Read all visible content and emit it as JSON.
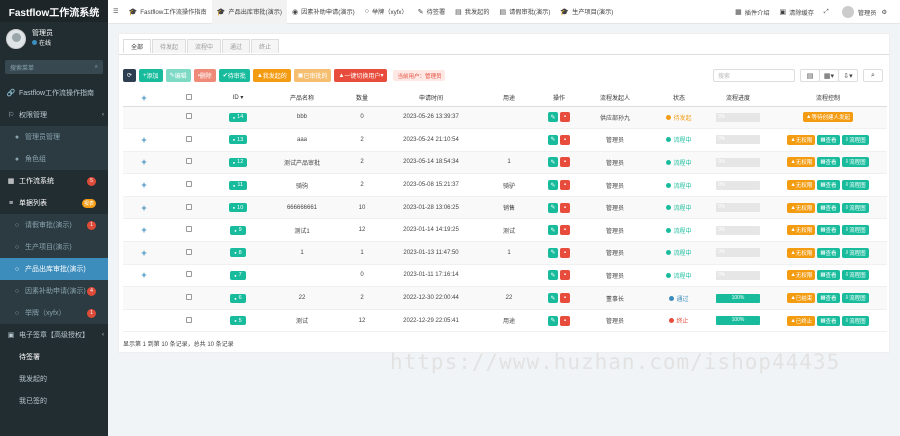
{
  "app": {
    "title": "Fastflow工作流系统"
  },
  "user": {
    "name": "管理员",
    "status": "在线"
  },
  "search": {
    "placeholder": "搜索菜单"
  },
  "menu": [
    {
      "label": "Fastflow工作流操作指南",
      "icon": "link-icon",
      "active": false
    },
    {
      "label": "权限管理",
      "icon": "shield-icon",
      "arrow": "‹"
    },
    {
      "label": "管理员管理",
      "icon": "user-icon",
      "sub": true
    },
    {
      "label": "角色组",
      "icon": "group-icon",
      "sub": true
    },
    {
      "label": "工作流系统",
      "icon": "flow-icon",
      "badge": "5",
      "badge_color": "red",
      "parent": true
    },
    {
      "label": "单据列表",
      "icon": "list-icon",
      "badge": "报表",
      "badge_color": "orange",
      "parent": true
    },
    {
      "label": "请假审批(演示)",
      "icon": "circle-icon",
      "sub": true,
      "badge": "1",
      "badge_color": "red"
    },
    {
      "label": "生产项目(演示)",
      "icon": "circle-icon",
      "sub": true
    },
    {
      "label": "产品出库审批(演示)",
      "icon": "circle-icon",
      "sub": true,
      "active": true
    },
    {
      "label": "因素补助申请(演示)",
      "icon": "circle-icon",
      "sub": true,
      "badge": "4",
      "badge_color": "red"
    },
    {
      "label": "举牌（xyfx）",
      "icon": "circle-icon",
      "sub": true,
      "badge": "1",
      "badge_color": "red"
    },
    {
      "label": "电子签章【高级授权】",
      "icon": "stamp-icon",
      "arrow": "‹"
    },
    {
      "label": "待签署",
      "icon": "",
      "parent": true
    },
    {
      "label": "我发起的",
      "icon": ""
    },
    {
      "label": "我已签的",
      "icon": ""
    }
  ],
  "topbar": {
    "tabs": [
      {
        "label": "Fastflow工作流操作指南",
        "icon": "cap-icon"
      },
      {
        "label": "产品出库审批(演示)",
        "icon": "cap-icon",
        "active": true
      },
      {
        "label": "因素补助申请(演示)",
        "icon": "eye-icon"
      },
      {
        "label": "举牌（xyfx）",
        "icon": "circle-icon"
      },
      {
        "label": "待签署",
        "icon": "pen-icon"
      },
      {
        "label": "我发起的",
        "icon": "doc-icon"
      },
      {
        "label": "请假审批(演示)",
        "icon": "doc-icon"
      },
      {
        "label": "生产项目(演示)",
        "icon": "cap-icon"
      }
    ],
    "right": {
      "plugin": "插件介绍",
      "clear": "清除缓存",
      "user": "管理员"
    }
  },
  "filter_tabs": [
    "全部",
    "待发起",
    "流程中",
    "通过",
    "终止"
  ],
  "toolbar": {
    "add": "添加",
    "edit": "编辑",
    "delete": "删除",
    "pending": "待审批",
    "mine": "我发起的",
    "done": "已审批的",
    "switch_user": "一键切换用户",
    "current_user": "当前用户：管理员"
  },
  "table_search": {
    "placeholder": "搜索"
  },
  "columns": [
    "ID",
    "产品名称",
    "数量",
    "申请时间",
    "用途",
    "操作",
    "流程发起人",
    "状态",
    "流程进度",
    "流程控制"
  ],
  "rows": [
    {
      "id": "14",
      "name": "bbb",
      "qty": "0",
      "time": "2023-05-26 13:39:37",
      "use": "",
      "initiator": "供应部孙九",
      "status": "待发起",
      "status_color": "#f39c12",
      "progress": "0%",
      "progress_value": 0,
      "controls": [
        "等待创建人发起"
      ],
      "expand": false
    },
    {
      "id": "13",
      "name": "aaa",
      "qty": "2",
      "time": "2023-05-24 21:10:54",
      "use": "",
      "initiator": "管理员",
      "status": "流程中",
      "status_color": "#18bc9c",
      "progress": "0%",
      "progress_value": 0,
      "controls": [
        "无权限",
        "查看",
        "流程图"
      ],
      "expand": true
    },
    {
      "id": "12",
      "name": "测试产品审批",
      "qty": "2",
      "time": "2023-05-14 18:54:34",
      "use": "1",
      "initiator": "管理员",
      "status": "流程中",
      "status_color": "#18bc9c",
      "progress": "0%",
      "progress_value": 0,
      "controls": [
        "无权限",
        "查看",
        "流程图"
      ],
      "expand": true
    },
    {
      "id": "11",
      "name": "骑驹",
      "qty": "2",
      "time": "2023-05-08 15:21:37",
      "use": "骑驴",
      "initiator": "管理员",
      "status": "流程中",
      "status_color": "#18bc9c",
      "progress": "0%",
      "progress_value": 0,
      "controls": [
        "无权限",
        "查看",
        "流程图"
      ],
      "expand": true
    },
    {
      "id": "10",
      "name": "666666661",
      "qty": "10",
      "time": "2023-01-28 13:06:25",
      "use": "销售",
      "initiator": "管理员",
      "status": "流程中",
      "status_color": "#18bc9c",
      "progress": "0%",
      "progress_value": 0,
      "controls": [
        "无权限",
        "查看",
        "流程图"
      ],
      "expand": true
    },
    {
      "id": "9",
      "name": "测试1",
      "qty": "12",
      "time": "2023-01-14 14:19:25",
      "use": "测试",
      "initiator": "管理员",
      "status": "流程中",
      "status_color": "#18bc9c",
      "progress": "0%",
      "progress_value": 0,
      "controls": [
        "无权限",
        "查看",
        "流程图"
      ],
      "expand": true
    },
    {
      "id": "8",
      "name": "1",
      "qty": "1",
      "time": "2023-01-13 11:47:50",
      "use": "1",
      "initiator": "管理员",
      "status": "流程中",
      "status_color": "#18bc9c",
      "progress": "0%",
      "progress_value": 0,
      "controls": [
        "无权限",
        "查看",
        "流程图"
      ],
      "expand": true
    },
    {
      "id": "7",
      "name": "",
      "qty": "0",
      "time": "2023-01-11 17:16:14",
      "use": "",
      "initiator": "管理员",
      "status": "流程中",
      "status_color": "#18bc9c",
      "progress": "0%",
      "progress_value": 0,
      "controls": [
        "无权限",
        "查看",
        "流程图"
      ],
      "expand": true
    },
    {
      "id": "6",
      "name": "22",
      "qty": "2",
      "time": "2022-12-30 22:00:44",
      "use": "22",
      "initiator": "董事长",
      "status": "通过",
      "status_color": "#3c8dbc",
      "progress": "100%",
      "progress_value": 100,
      "controls": [
        "已结束",
        "查看",
        "流程图"
      ],
      "expand": false
    },
    {
      "id": "5",
      "name": "测试",
      "qty": "12",
      "time": "2022-12-29 22:05:41",
      "use": "用途",
      "initiator": "管理员",
      "status": "终止",
      "status_color": "#e74c3c",
      "progress": "100%",
      "progress_value": 100,
      "controls": [
        "已终止",
        "查看",
        "流程图"
      ],
      "expand": false
    }
  ],
  "pagination": {
    "info": "显示第 1 到第 10 条记录，总共 10 条记录"
  },
  "watermark": "https://www.huzhan.com/ishop44435"
}
